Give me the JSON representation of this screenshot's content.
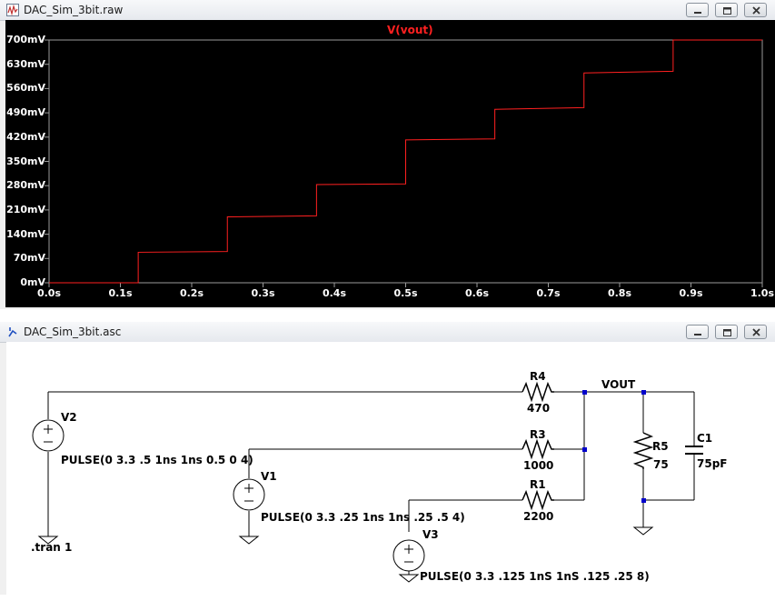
{
  "plot_window": {
    "title": "DAC_Sim_3bit.raw",
    "controls": [
      "minimize",
      "restore",
      "close"
    ]
  },
  "schematic_window": {
    "title": "DAC_Sim_3bit.asc",
    "controls": [
      "minimize",
      "restore",
      "close"
    ]
  },
  "chart_data": {
    "type": "line",
    "title": "V(vout)",
    "xlabel": "",
    "ylabel": "",
    "x_ticks": [
      "0.0s",
      "0.1s",
      "0.2s",
      "0.3s",
      "0.4s",
      "0.5s",
      "0.6s",
      "0.7s",
      "0.8s",
      "0.9s",
      "1.0s"
    ],
    "y_ticks": [
      "0mV",
      "70mV",
      "140mV",
      "210mV",
      "280mV",
      "350mV",
      "420mV",
      "490mV",
      "560mV",
      "630mV",
      "700mV"
    ],
    "xlim": [
      0,
      1.0
    ],
    "ylim": [
      0,
      700
    ],
    "background": "#000000",
    "grid": false,
    "series": [
      {
        "name": "V(vout)",
        "color": "#ff2020",
        "x": [
          0,
          0.125,
          0.125,
          0.25,
          0.25,
          0.375,
          0.375,
          0.5,
          0.5,
          0.625,
          0.625,
          0.75,
          0.75,
          0.875,
          0.875,
          1.0
        ],
        "y": [
          0,
          0,
          88,
          90,
          190,
          193,
          283,
          285,
          412,
          415,
          500,
          505,
          605,
          610,
          700,
          700
        ]
      }
    ]
  },
  "schematic": {
    "components": {
      "r4": {
        "name": "R4",
        "value": "470"
      },
      "r3": {
        "name": "R3",
        "value": "1000"
      },
      "r1": {
        "name": "R1",
        "value": "2200"
      },
      "r5": {
        "name": "R5",
        "value": "75"
      },
      "c1": {
        "name": "C1",
        "value": "75pF"
      },
      "v2": {
        "name": "V2",
        "value": "PULSE(0 3.3 .5 1ns 1ns 0.5 0 4)"
      },
      "v1": {
        "name": "V1",
        "value": "PULSE(0 3.3 .25 1ns 1ns .25 .5 4)"
      },
      "v3": {
        "name": "V3",
        "value": "PULSE(0 3.3 .125 1nS 1nS .125 .25 8)"
      }
    },
    "net_label": "VOUT",
    "directive": ".tran 1",
    "wire_color": "#000000",
    "junction_color": "#0000cc",
    "symbol_color": "#000000"
  }
}
